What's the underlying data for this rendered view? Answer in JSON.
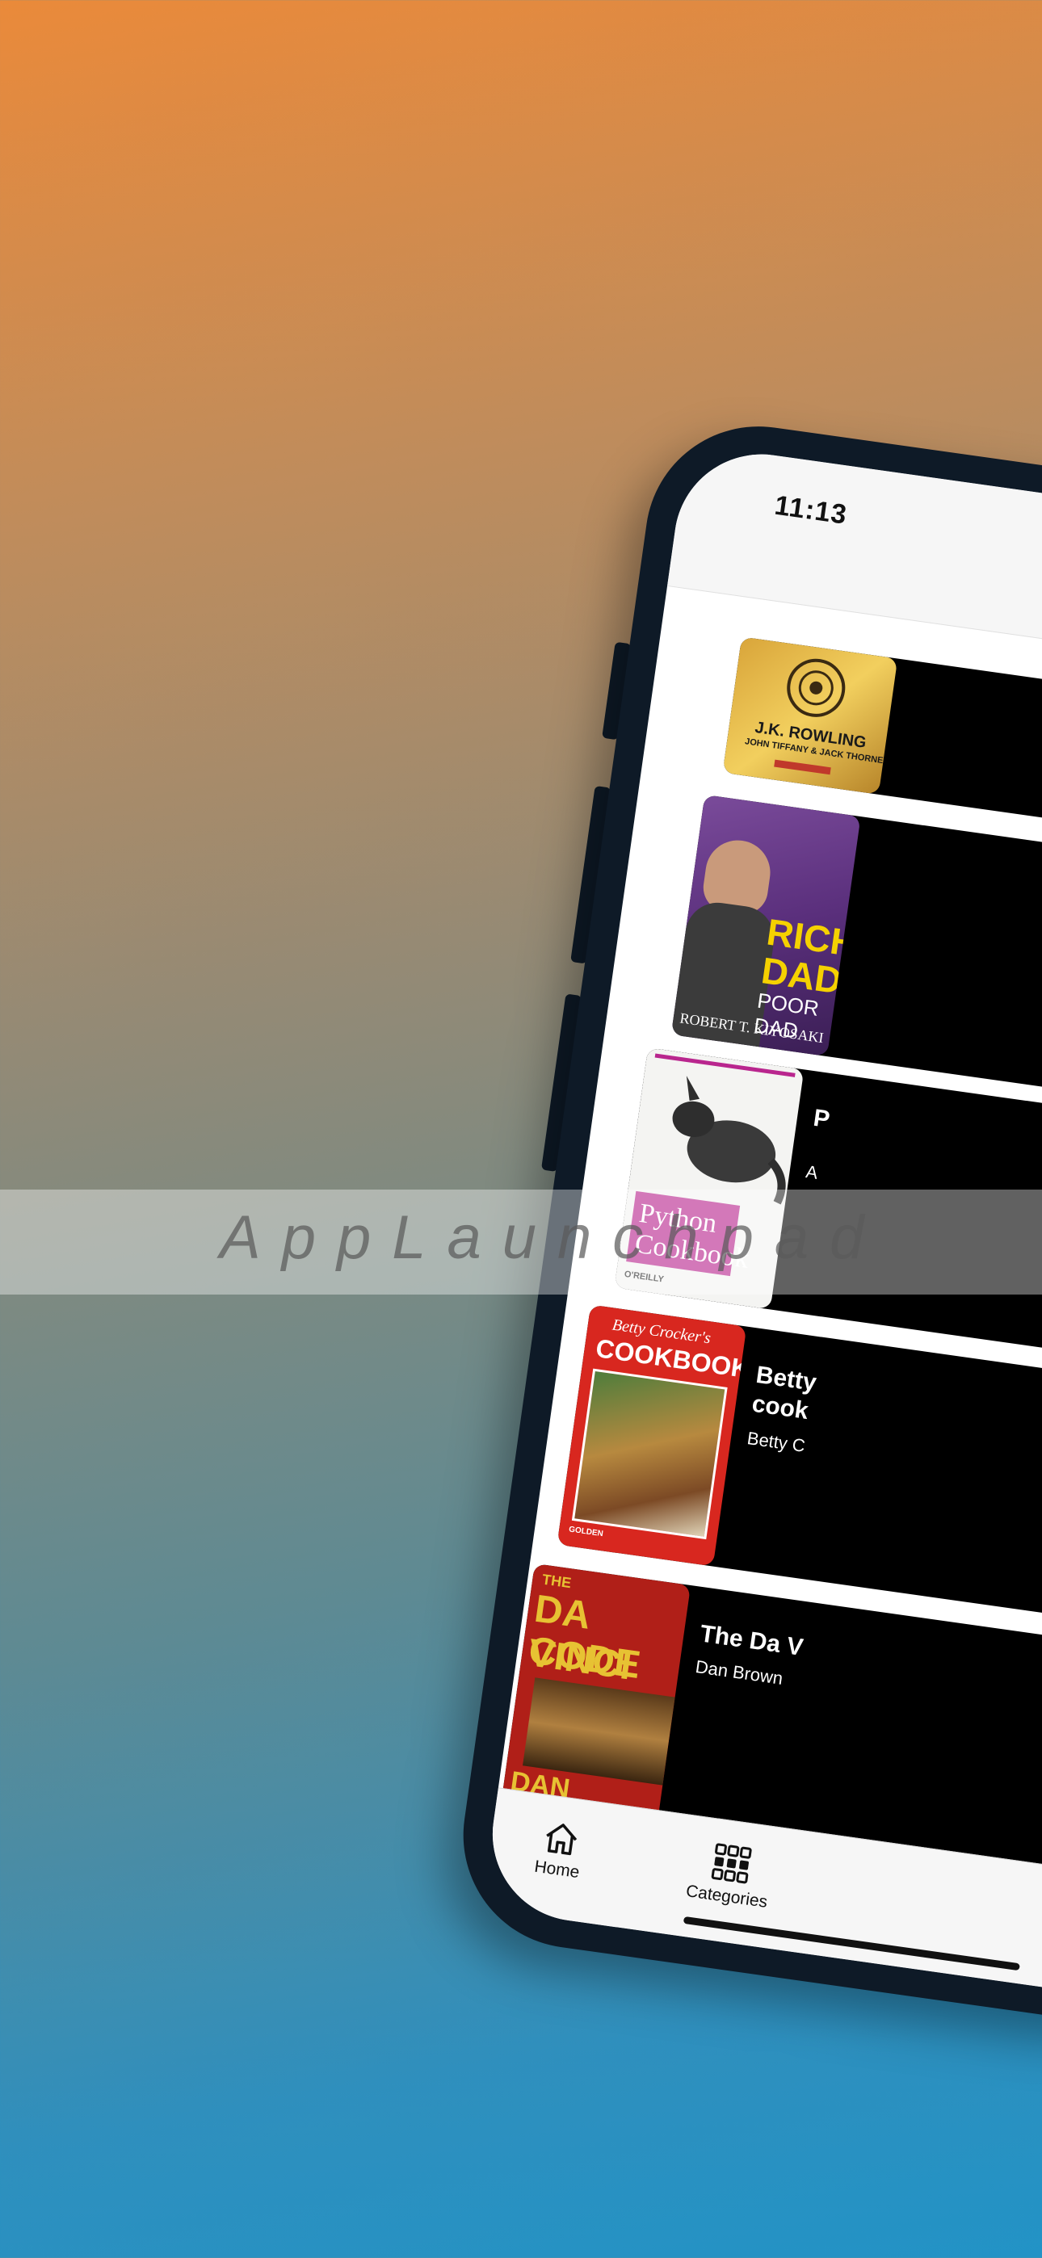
{
  "app": {
    "banner_text": "AppLaunchpad"
  },
  "status_bar": {
    "time": "11:13"
  },
  "books": [
    {
      "title": "",
      "author": "",
      "cover_text": [
        "J.K. ROWLING",
        "JOHN TIFFANY & JACK THORNE"
      ]
    },
    {
      "title": "",
      "author": "",
      "cover_text": [
        "RICH",
        "DAD",
        "POOR DAD",
        "ROBERT T. KIYOSAKI"
      ]
    },
    {
      "title": "P",
      "author": "A",
      "cover_text": [
        "Python",
        "Cookbook",
        "O'REILLY"
      ]
    },
    {
      "title": "Betty",
      "title2": "cook",
      "author": "Betty C",
      "cover_text": [
        "Betty Crocker's",
        "COOKBOOK",
        "GOLDEN"
      ]
    },
    {
      "title": "The Da V",
      "author": "Dan Brown",
      "cover_text": [
        "THE",
        "DA VINCI",
        "CODE",
        "DAN BROWN"
      ]
    }
  ],
  "tab_bar": {
    "home": {
      "label": "Home",
      "icon": "home-icon"
    },
    "categories": {
      "label": "Categories",
      "icon": "grid-icon"
    }
  },
  "colors": {
    "accent": "#2293c6",
    "warm": "#ea8a3a",
    "frame": "#0e1a27"
  }
}
